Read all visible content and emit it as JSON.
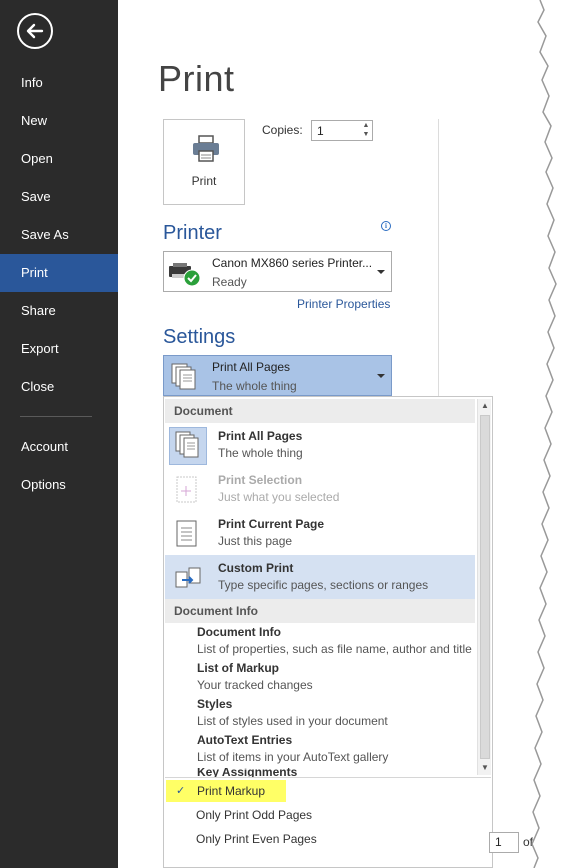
{
  "sidebar": {
    "items": [
      {
        "label": "Info"
      },
      {
        "label": "New"
      },
      {
        "label": "Open"
      },
      {
        "label": "Save"
      },
      {
        "label": "Save As"
      },
      {
        "label": "Print"
      },
      {
        "label": "Share"
      },
      {
        "label": "Export"
      },
      {
        "label": "Close"
      },
      {
        "label": "Account"
      },
      {
        "label": "Options"
      }
    ],
    "active": "Print",
    "back_icon": "back-arrow-icon"
  },
  "main": {
    "title": "Print",
    "print_button_label": "Print",
    "copies_label": "Copies:",
    "copies_value": "1",
    "printer": {
      "heading": "Printer",
      "name": "Canon MX860 series Printer...",
      "status": "Ready",
      "properties_link": "Printer Properties"
    },
    "settings": {
      "heading": "Settings",
      "selected_title": "Print All Pages",
      "selected_sub": "The whole thing"
    },
    "dropdown": {
      "document_heading": "Document",
      "options": [
        {
          "title": "Print All Pages",
          "sub": "The whole thing"
        },
        {
          "title": "Print Selection",
          "sub": "Just what you selected"
        },
        {
          "title": "Print Current Page",
          "sub": "Just this page"
        },
        {
          "title": "Custom Print",
          "sub": "Type specific pages, sections or ranges"
        }
      ],
      "info_heading": "Document Info",
      "info_items": [
        {
          "title": "Document Info",
          "sub": "List of properties, such as file name, author and title"
        },
        {
          "title": "List of Markup",
          "sub": "Your tracked changes"
        },
        {
          "title": "Styles",
          "sub": "List of styles used in your document"
        },
        {
          "title": "AutoText Entries",
          "sub": "List of items in your AutoText gallery"
        },
        {
          "title": "Key Assignments",
          "sub": ""
        }
      ],
      "toggles": [
        {
          "label": "Print Markup",
          "checked": true
        },
        {
          "label": "Only Print Odd Pages",
          "checked": false
        },
        {
          "label": "Only Print Even Pages",
          "checked": false
        }
      ]
    },
    "page_nav": {
      "current": "1",
      "of_label": "of"
    }
  },
  "colors": {
    "sidebar_bg": "#2b2b2b",
    "accent": "#2a579a",
    "selection": "#a9c3e6",
    "highlight": "#ffff66"
  }
}
